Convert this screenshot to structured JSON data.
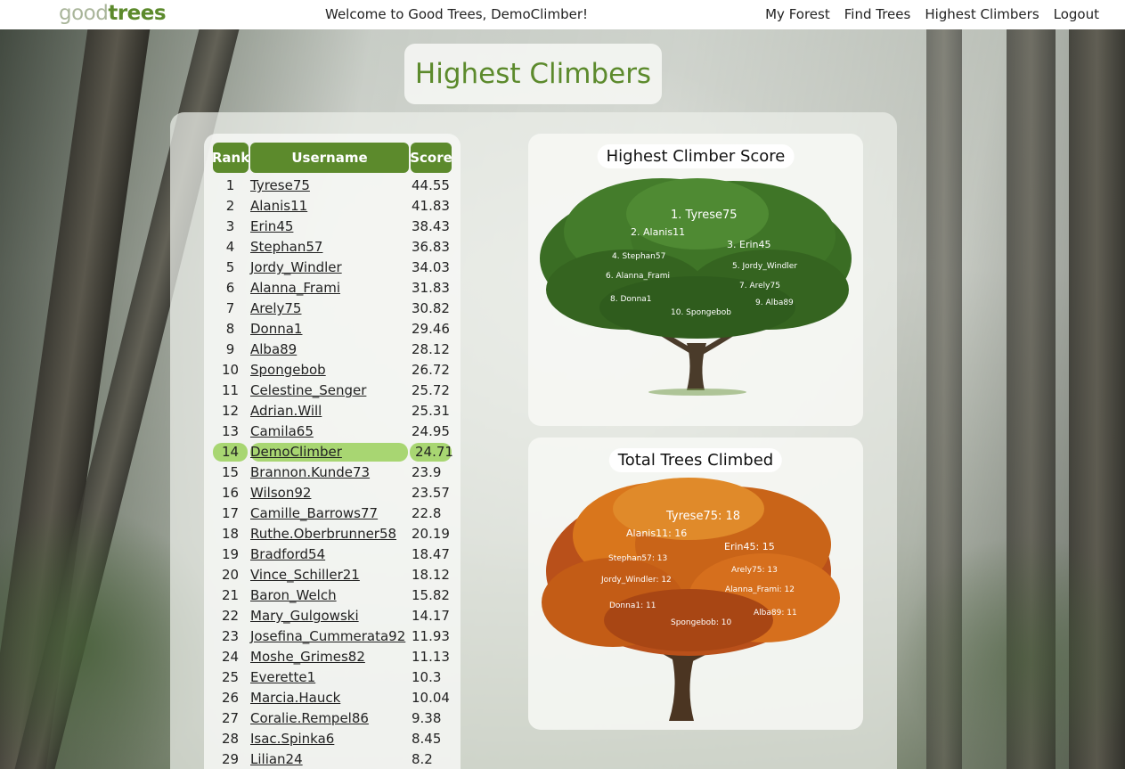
{
  "nav": {
    "logo_part1": "good",
    "logo_part2": "trees",
    "welcome": "Welcome to Good Trees, DemoClimber!",
    "links": [
      "My Forest",
      "Find Trees",
      "Highest Climbers",
      "Logout"
    ]
  },
  "page_title": "Highest Climbers",
  "table": {
    "headers": [
      "Rank",
      "Username",
      "Score"
    ],
    "current_user": "DemoClimber",
    "rows": [
      {
        "rank": "1",
        "username": "Tyrese75",
        "score": "44.55"
      },
      {
        "rank": "2",
        "username": "Alanis11",
        "score": "41.83"
      },
      {
        "rank": "3",
        "username": "Erin45",
        "score": "38.43"
      },
      {
        "rank": "4",
        "username": "Stephan57",
        "score": "36.83"
      },
      {
        "rank": "5",
        "username": "Jordy_Windler",
        "score": "34.03"
      },
      {
        "rank": "6",
        "username": "Alanna_Frami",
        "score": "31.83"
      },
      {
        "rank": "7",
        "username": "Arely75",
        "score": "30.82"
      },
      {
        "rank": "8",
        "username": "Donna1",
        "score": "29.46"
      },
      {
        "rank": "9",
        "username": "Alba89",
        "score": "28.12"
      },
      {
        "rank": "10",
        "username": "Spongebob",
        "score": "26.72"
      },
      {
        "rank": "11",
        "username": "Celestine_Senger",
        "score": "25.72"
      },
      {
        "rank": "12",
        "username": "Adrian.Will",
        "score": "25.31"
      },
      {
        "rank": "13",
        "username": "Camila65",
        "score": "24.95"
      },
      {
        "rank": "14",
        "username": "DemoClimber",
        "score": "24.71"
      },
      {
        "rank": "15",
        "username": "Brannon.Kunde73",
        "score": "23.9"
      },
      {
        "rank": "16",
        "username": "Wilson92",
        "score": "23.57"
      },
      {
        "rank": "17",
        "username": "Camille_Barrows77",
        "score": "22.8"
      },
      {
        "rank": "18",
        "username": "Ruthe.Oberbrunner58",
        "score": "20.19"
      },
      {
        "rank": "19",
        "username": "Bradford54",
        "score": "18.47"
      },
      {
        "rank": "20",
        "username": "Vince_Schiller21",
        "score": "18.12"
      },
      {
        "rank": "21",
        "username": "Baron_Welch",
        "score": "15.82"
      },
      {
        "rank": "22",
        "username": "Mary_Gulgowski",
        "score": "14.17"
      },
      {
        "rank": "23",
        "username": "Josefina_Cummerata92",
        "score": "11.93"
      },
      {
        "rank": "24",
        "username": "Moshe_Grimes82",
        "score": "11.13"
      },
      {
        "rank": "25",
        "username": "Everette1",
        "score": "10.3"
      },
      {
        "rank": "26",
        "username": "Marcia.Hauck",
        "score": "10.04"
      },
      {
        "rank": "27",
        "username": "Coralie.Rempel86",
        "score": "9.38"
      },
      {
        "rank": "28",
        "username": "Isac.Spinka6",
        "score": "8.45"
      },
      {
        "rank": "29",
        "username": "Lilian24",
        "score": "8.2"
      }
    ]
  },
  "chart_data": [
    {
      "type": "other",
      "title": "Highest Climber Score",
      "labels": [
        "1. Tyrese75",
        "2. Alanis11",
        "3. Erin45",
        "4. Stephan57",
        "5. Jordy_Windler",
        "6. Alanna_Frami",
        "7. Arely75",
        "8. Donna1",
        "9. Alba89",
        "10. Spongebob"
      ]
    },
    {
      "type": "other",
      "title": "Total Trees Climbed",
      "labels": [
        "Tyrese75: 18",
        "Alanis11: 16",
        "Erin45: 15",
        "Stephan57: 13",
        "Arely75: 13",
        "Jordy_Windler: 12",
        "Alanna_Frami: 12",
        "Donna1: 11",
        "Alba89: 11",
        "Spongebob: 10"
      ],
      "series": [
        {
          "values": [
            18,
            16,
            15,
            13,
            13,
            12,
            12,
            11,
            11,
            10
          ]
        }
      ]
    }
  ],
  "colors": {
    "brand_green": "#5c8a2c",
    "highlight_green": "#a8d672",
    "canopy_green": "#3f7a2a",
    "canopy_orange": "#d9761c"
  }
}
